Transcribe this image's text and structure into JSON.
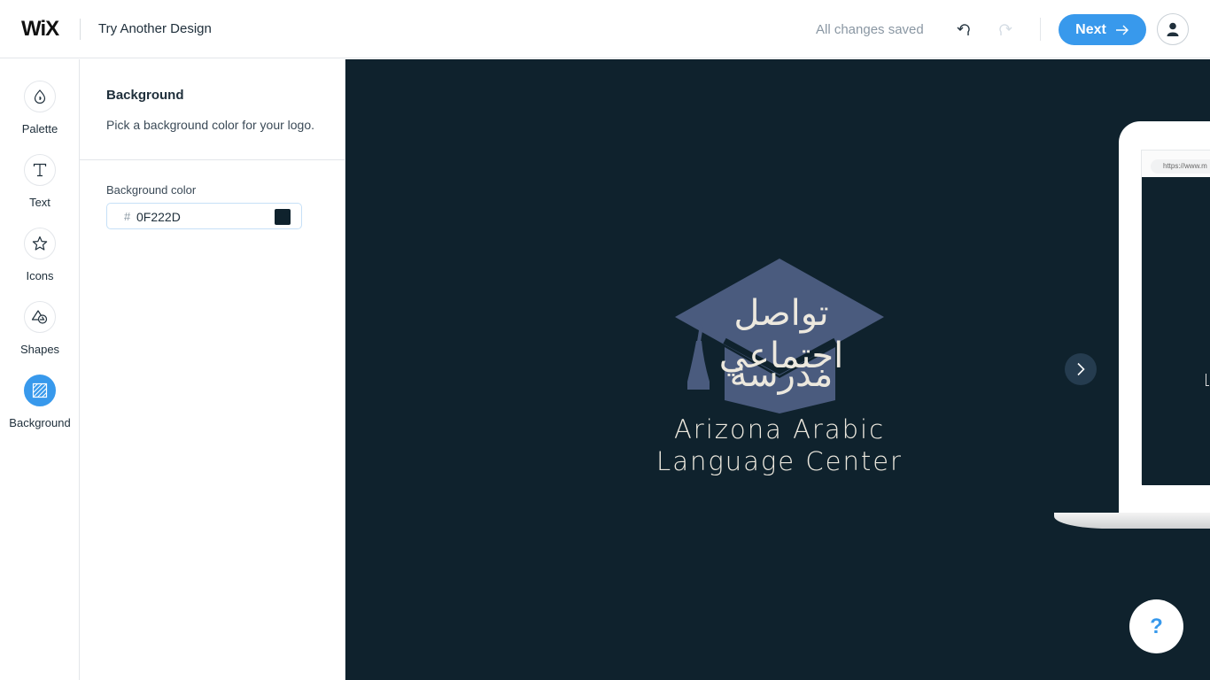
{
  "header": {
    "brand": "WiX",
    "title": "Try Another Design",
    "save_status": "All changes saved",
    "undo_icon": "undo-icon",
    "redo_icon": "redo-icon",
    "next_label": "Next",
    "next_icon": "arrow-right-icon",
    "account_icon": "user-icon"
  },
  "sidebar": {
    "items": [
      {
        "label": "Palette",
        "icon": "palette-drop-icon",
        "active": false
      },
      {
        "label": "Text",
        "icon": "text-icon",
        "active": false
      },
      {
        "label": "Icons",
        "icon": "star-icon",
        "active": false
      },
      {
        "label": "Shapes",
        "icon": "shapes-icon",
        "active": false
      },
      {
        "label": "Background",
        "icon": "background-icon",
        "active": true
      }
    ]
  },
  "panel": {
    "title": "Background",
    "description": "Pick a background color for your logo.",
    "field_label": "Background color",
    "hash": "#",
    "color_value": "0F222D"
  },
  "colors": {
    "accent": "#3899EC",
    "background": "#0F222D",
    "logo_shape": "#4A5B7E",
    "logo_text": "#ECE8DE"
  },
  "logo": {
    "arabic_line1": "تواصل اجتماعي",
    "arabic_line2": "مدرسة",
    "english_line1": "Arizona Arabic",
    "english_line2": "Language Center",
    "symbol": "graduation-cap-icon"
  },
  "preview": {
    "url_text": "https://www.m",
    "next_icon": "chevron-right-icon"
  },
  "help": {
    "label": "?"
  }
}
